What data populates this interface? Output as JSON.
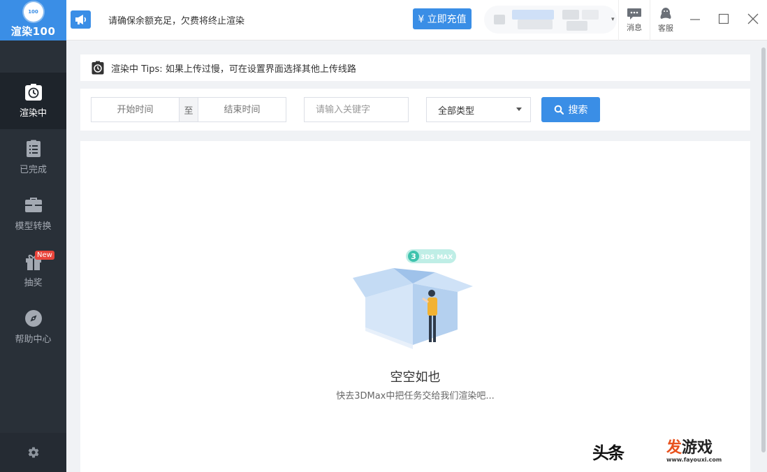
{
  "app": {
    "logo_badge": "100",
    "logo_text": "渲染100"
  },
  "sidebar": {
    "items": [
      {
        "label": "渲染中",
        "icon": "stopwatch-icon",
        "active": true
      },
      {
        "label": "已完成",
        "icon": "clipboard-list-icon",
        "active": false
      },
      {
        "label": "模型转换",
        "icon": "briefcase-icon",
        "active": false
      },
      {
        "label": "抽奖",
        "icon": "gift-icon",
        "active": false,
        "badge": "New"
      },
      {
        "label": "帮助中心",
        "icon": "compass-icon",
        "active": false
      }
    ],
    "settings_icon": "gear-icon"
  },
  "header": {
    "notice": "请确保余额充足，欠费将终止渲染",
    "recharge_label": "¥ 立即充值",
    "messages_label": "消息",
    "support_label": "客服"
  },
  "tips": {
    "text": "渲染中 Tips: 如果上传过慢，可在设置界面选择其他上传线路"
  },
  "filter": {
    "start_placeholder": "开始时间",
    "range_separator": "至",
    "end_placeholder": "结束时间",
    "keyword_placeholder": "请输入关键字",
    "type_selected": "全部类型",
    "search_label": "搜索"
  },
  "empty": {
    "badge": "3DS MAX",
    "title": "空空如也",
    "subtitle": "快去3DMax中把任务交给我们渲染吧..."
  },
  "watermark": {
    "left_text": "头条",
    "site_name_a": "发",
    "site_name_b": "游戏",
    "site_url": "www.fayouxi.com"
  },
  "colors": {
    "accent": "#3a8ee6",
    "sidebar_bg": "#293038",
    "badge_red": "#e9453b"
  }
}
